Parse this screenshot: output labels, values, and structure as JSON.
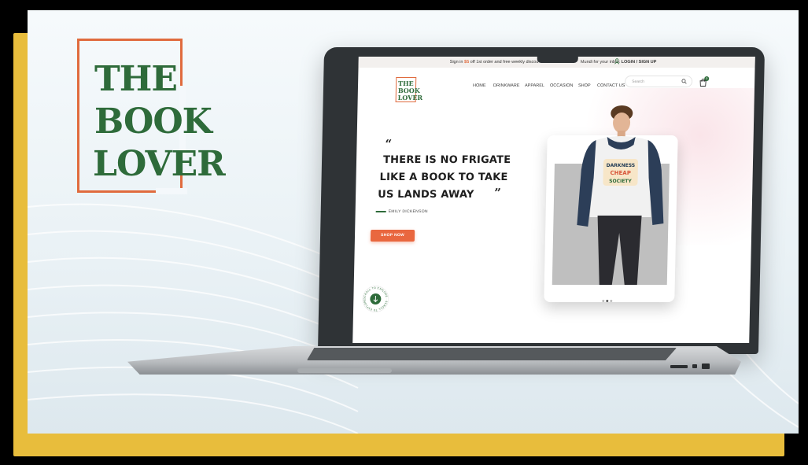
{
  "brand": {
    "line1": "THE",
    "line2": "BOOK",
    "line3": "LOVER"
  },
  "promo_bar": {
    "msg_prefix": "Sign in",
    "highlight": "$5",
    "msg_suffix": "off 1st order and free weekly discou",
    "msg_tail": "Mundi for your inbox",
    "login": "LOGIN / SIGN UP"
  },
  "site_logo": {
    "line1": "THE",
    "line2": "BOOK",
    "line3": "LOVER"
  },
  "nav": {
    "items": [
      "HOME",
      "DRINKWARE",
      "APPAREL",
      "OCCASION",
      "SHOP",
      "CONTACT US"
    ]
  },
  "search": {
    "placeholder": "Search"
  },
  "cart": {
    "count": "0"
  },
  "hero": {
    "open_quote": "“",
    "line1": "THERE IS NO FRIGATE",
    "line2": "LIKE A BOOK TO TAKE",
    "line3": "US LANDS AWAY",
    "close_quote": "”",
    "author": "EMILY DICKENSON",
    "cta": "SHOP NOW",
    "scroll_badge_text": "SCROLL TO EXPLORE · SCROLL TO EXPLORE ·"
  },
  "product": {
    "graphic_lines": [
      "DARKNESS",
      "CHEAP",
      "SOCIETY"
    ],
    "carousel_active_index": 1
  },
  "colors": {
    "brand_green": "#2e6b3a",
    "accent_orange": "#e9673f",
    "frame_yellow": "#e8bd3c"
  }
}
